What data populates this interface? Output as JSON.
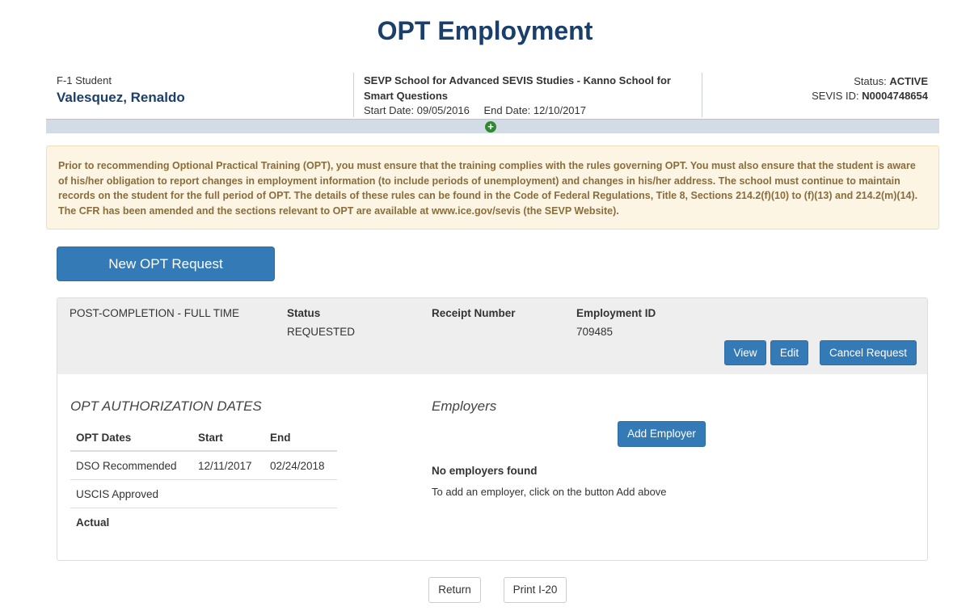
{
  "page_title": "OPT Employment",
  "student": {
    "type": "F-1 Student",
    "name": "Valesquez, Renaldo"
  },
  "school": {
    "name": "SEVP School for Advanced SEVIS Studies - Kanno School for Smart Questions",
    "start_label": "Start Date:",
    "start_date": "09/05/2016",
    "end_label": "End Date:",
    "end_date": "12/10/2017"
  },
  "status": {
    "status_label": "Status:",
    "status_value": "ACTIVE",
    "sevis_label": "SEVIS ID:",
    "sevis_value": "N0004748654"
  },
  "warning_text": "Prior to recommending Optional Practical Training (OPT), you must ensure that the training complies with the rules governing OPT. You must also ensure that the student is aware of his/her obligation to report changes in employment information (to include periods of unemployment) and changes in his/her address. The school must continue to maintain records on the student for the full period of OPT. The details of these rules can be found in the Code of Federal Regulations, Title 8, Sections 214.2(f)(10) to (f)(13) and 214.2(m)(14). The CFR has been amended and the sections relevant to OPT are available at www.ice.gov/sevis (the SEVP Website).",
  "new_request_label": "New OPT Request",
  "request": {
    "type": "POST-COMPLETION - FULL TIME",
    "status_label": "Status",
    "status_value": "REQUESTED",
    "receipt_label": "Receipt Number",
    "receipt_value": "",
    "employment_id_label": "Employment ID",
    "employment_id_value": "709485",
    "view_label": "View",
    "edit_label": "Edit",
    "cancel_label": "Cancel Request"
  },
  "auth_dates": {
    "title": "OPT AUTHORIZATION DATES",
    "headers": [
      "OPT Dates",
      "Start",
      "End"
    ],
    "rows": [
      [
        "DSO Recommended",
        "12/11/2017",
        "02/24/2018"
      ],
      [
        "USCIS Approved",
        "",
        ""
      ],
      [
        "Actual",
        "",
        ""
      ]
    ]
  },
  "employers": {
    "title": "Employers",
    "add_label": "Add Employer",
    "empty_title": "No employers found",
    "empty_hint": "To add an employer, click on the button Add above"
  },
  "footer": {
    "return_label": "Return",
    "print_label": "Print I-20"
  },
  "icons": {
    "expand": "plus-circle-icon"
  },
  "colors": {
    "primary": "#337ab7",
    "title": "#1b3f6b",
    "warning_bg": "#fcf5e4",
    "warning_text": "#8a6d3b",
    "expand_icon": "#2f8a2f"
  }
}
